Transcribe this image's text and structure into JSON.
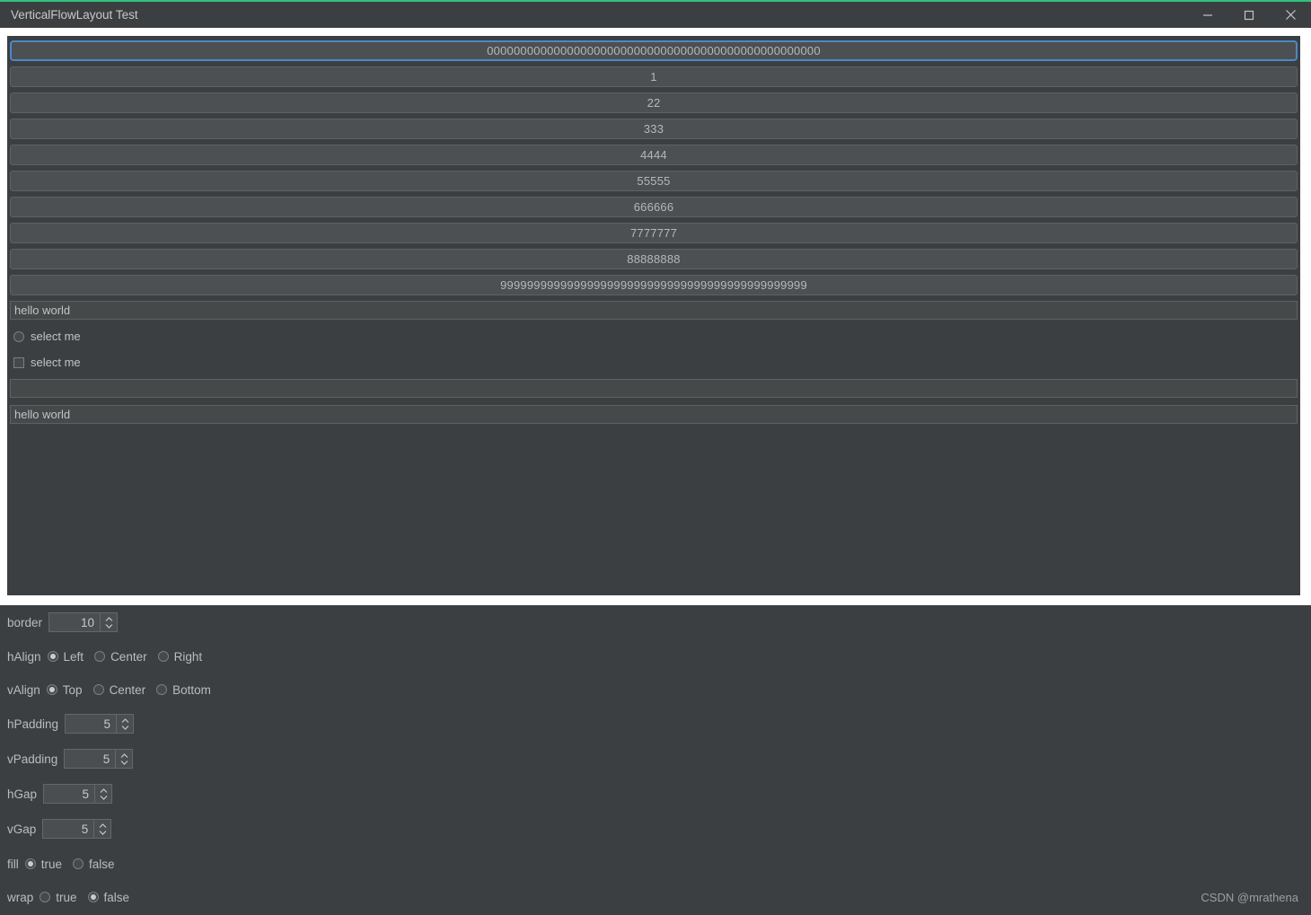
{
  "window": {
    "title": "VerticalFlowLayout Test",
    "accent_green": "#2ec27e",
    "controls": {
      "minimize": "minimize-icon",
      "maximize": "maximize-icon",
      "close": "close-icon"
    }
  },
  "flow_panel": {
    "buttons": [
      "00000000000000000000000000000000000000000000000000",
      "1",
      "22",
      "333",
      "4444",
      "55555",
      "666666",
      "7777777",
      "88888888",
      "9999999999999999999999999999999999999999999999"
    ],
    "focused_index": 0,
    "focus_color": "#4a88c7",
    "fields": [
      {
        "name": "text-field-1",
        "value": "hello world"
      },
      {
        "name": "text-field-2",
        "value": ""
      },
      {
        "name": "text-field-3",
        "value": "hello world"
      }
    ],
    "radio": {
      "label": "select me",
      "checked": false
    },
    "checkbox": {
      "label": "select me",
      "checked": false
    }
  },
  "controls": {
    "border": {
      "label": "border",
      "value": "10"
    },
    "hAlign": {
      "label": "hAlign",
      "options": [
        "Left",
        "Center",
        "Right"
      ],
      "selected": "Left"
    },
    "vAlign": {
      "label": "vAlign",
      "options": [
        "Top",
        "Center",
        "Bottom"
      ],
      "selected": "Top"
    },
    "hPadding": {
      "label": "hPadding",
      "value": "5"
    },
    "vPadding": {
      "label": "vPadding",
      "value": "5"
    },
    "hGap": {
      "label": "hGap",
      "value": "5"
    },
    "vGap": {
      "label": "vGap",
      "value": "5"
    },
    "fill": {
      "label": "fill",
      "options": [
        "true",
        "false"
      ],
      "selected": "true"
    },
    "wrap": {
      "label": "wrap",
      "options": [
        "true",
        "false"
      ],
      "selected": "false"
    }
  },
  "watermark": "CSDN @mrathena"
}
